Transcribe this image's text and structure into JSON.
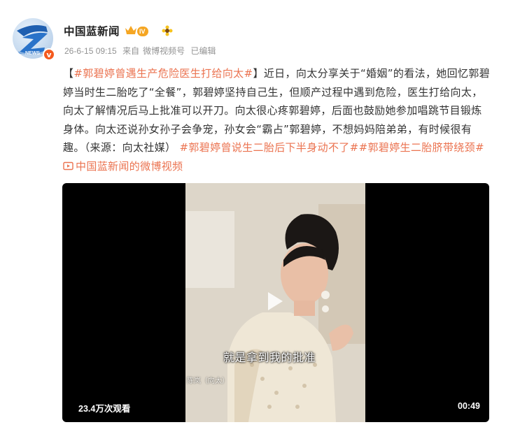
{
  "account": {
    "name": "中国蓝新闻",
    "level_badge": "IV",
    "verified_badge": "v",
    "avatar_icon": "zhejiang-news-logo-icon",
    "avatar_text": "NEWS"
  },
  "post": {
    "time": "26-6-15 09:15",
    "from_label": "来自",
    "source": "微博视频号",
    "edited": "已编辑",
    "bracket_open": "【",
    "headline_tag": "#郭碧婷曾遇生产危险医生打给向太#",
    "bracket_close": "】",
    "body": "近日，向太分享关于“婚姻”的看法，她回忆郭碧婷当时生二胎吃了“全餐”，郭碧婷坚持自己生，但顺产过程中遇到危险，医生打给向太，向太了解情况后马上批准可以开刀。向太很心疼郭碧婷，后面也鼓励她参加唱跳节目锻炼身体。向太还说孙女孙子会争宠，孙女会“霸占”郭碧婷，不想妈妈陪弟弟，有时候很有趣。（来源：向太社媒）",
    "tags": [
      "#郭碧婷曾说生二胎后下半身动不了#",
      "#郭碧婷生二胎脐带绕颈#"
    ],
    "video_link_icon": "video-link-icon",
    "video_link_text": "中国蓝新闻的微博视频"
  },
  "video": {
    "subtitle": "就是拿到我的批准",
    "caption_tag": "陈岚（向太）",
    "views": "23.4万次观看",
    "duration": "00:49",
    "play_icon": "play-icon"
  },
  "colors": {
    "accent": "#eb7350",
    "text": "#333333",
    "meta": "#939393",
    "badge": "#f45a1e"
  }
}
